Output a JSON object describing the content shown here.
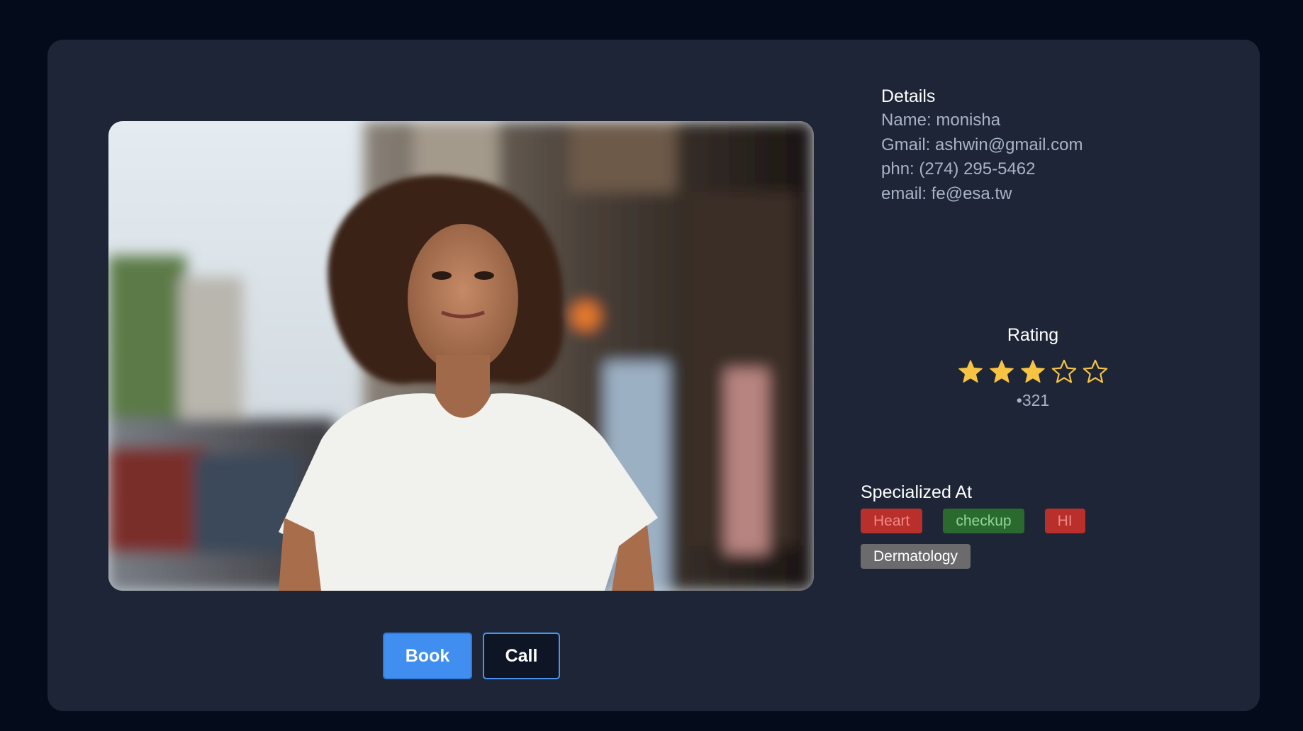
{
  "profile": {
    "photo_alt": "portrait-photo"
  },
  "actions": {
    "book_label": "Book",
    "call_label": "Call"
  },
  "details": {
    "title": "Details",
    "name": "Name: monisha",
    "gmail": "Gmail: ashwin@gmail.com",
    "phone": "phn: (274) 295-5462",
    "email": "email: fe@esa.tw"
  },
  "rating": {
    "title": "Rating",
    "stars_filled": 3,
    "stars_total": 5,
    "count": "•321",
    "star_color": "#f6c343"
  },
  "specialized": {
    "title": "Specialized At",
    "tags": [
      {
        "label": "Heart",
        "color": "red"
      },
      {
        "label": "checkup",
        "color": "green"
      },
      {
        "label": "HI",
        "color": "red"
      },
      {
        "label": "Dermatology",
        "color": "gray"
      }
    ]
  }
}
